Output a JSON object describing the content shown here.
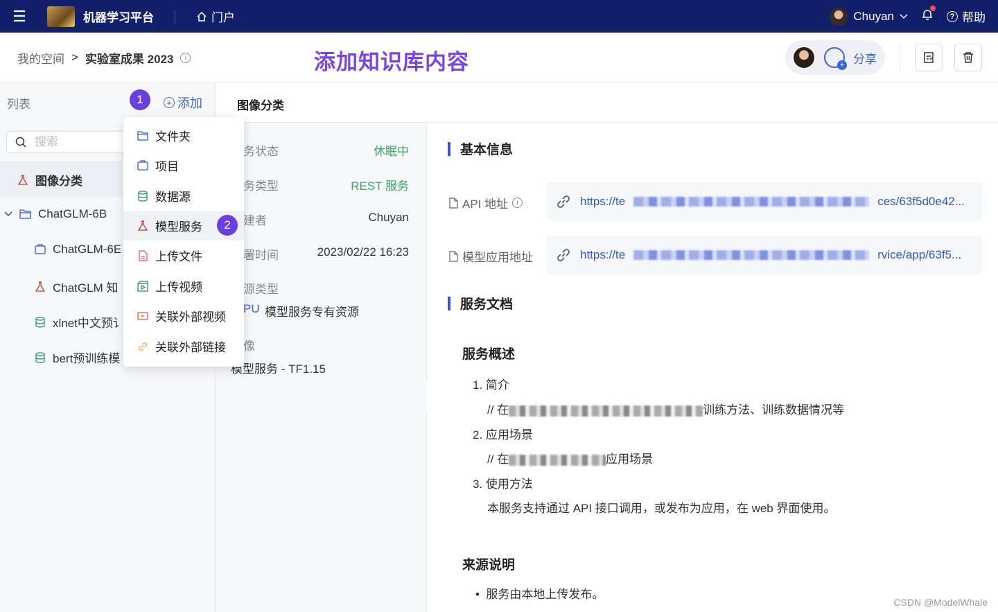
{
  "topbar": {
    "app_title": "机器学习平台",
    "portal_label": "门户",
    "user_name": "Chuyan",
    "help_label": "帮助"
  },
  "header": {
    "breadcrumb_root": "我的空间",
    "breadcrumb_sep": ">",
    "breadcrumb_current": "实验室成果 2023",
    "annotation_title": "添加知识库内容",
    "share_label": "分享"
  },
  "left": {
    "list_label": "列表",
    "add_label": "添加",
    "search_placeholder": "搜索",
    "tree": [
      {
        "label": "图像分类"
      },
      {
        "label": "ChatGLM-6B"
      },
      {
        "label": "ChatGLM-6E"
      },
      {
        "label": "ChatGLM 知"
      },
      {
        "label": "xlnet中文预讠"
      },
      {
        "label": "bert预训练模"
      }
    ]
  },
  "badges": {
    "one": "1",
    "two": "2"
  },
  "dropdown": {
    "items": [
      {
        "label": "文件夹",
        "icon": "folder-icon"
      },
      {
        "label": "项目",
        "icon": "project-icon"
      },
      {
        "label": "数据源",
        "icon": "database-icon"
      },
      {
        "label": "模型服务",
        "icon": "flask-icon"
      },
      {
        "label": "上传文件",
        "icon": "file-icon"
      },
      {
        "label": "上传视频",
        "icon": "video-upload-icon"
      },
      {
        "label": "关联外部视频",
        "icon": "video-link-icon"
      },
      {
        "label": "关联外部链接",
        "icon": "link-icon"
      }
    ]
  },
  "middle": {
    "title": "图像分类",
    "status_key": "务状态",
    "status_val": "休眠中",
    "type_key": "务类型",
    "type_val": "REST 服务",
    "creator_key": "建者",
    "creator_val": "Chuyan",
    "deploy_key": "署时间",
    "deploy_val": "2023/02/22 16:23",
    "resource_key": "源类型",
    "resource_prefix": "PU",
    "resource_val": "模型服务专有资源",
    "image_key": "像",
    "image_val": "模型服务 - TF1.15"
  },
  "right": {
    "basic_title": "基本信息",
    "api_label": "API 地址",
    "api_url_start": "https://te",
    "api_url_end": "ces/63f5d0e42...",
    "app_label": "模型应用地址",
    "app_url_start": "https://te",
    "app_url_end": "rvice/app/63f5...",
    "doc_title": "服务文档",
    "overview_title": "服务概述",
    "item1": "1. 简介",
    "item1_sub_start": "// 在",
    "item1_sub_end": "训练方法、训练数据情况等",
    "item2": "2. 应用场景",
    "item2_sub_start": "// 在",
    "item2_sub_end": "应用场景",
    "item3": "3. 使用方法",
    "item3_sub": "本服务支持通过 API 接口调用，或发布为应用，在 web 界面使用。",
    "source_title": "来源说明",
    "source_bullet": "服务由本地上传发布。"
  },
  "watermark": "CSDN @ModelWhale",
  "colors": {
    "topbar": "#12206b",
    "accent": "#3a64d8",
    "badge": "#6a3fe0",
    "status": "#3aa55d"
  }
}
